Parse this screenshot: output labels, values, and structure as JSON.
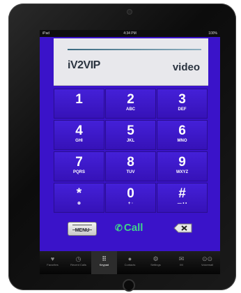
{
  "status_bar": {
    "carrier": "iPad",
    "time": "4:34 PM",
    "battery": "100%"
  },
  "display": {
    "logo_prefix": "iV",
    "logo_two": "2",
    "logo_suffix": "VIP",
    "mode_label": "video"
  },
  "keypad": {
    "keys": [
      {
        "digit": "1",
        "letters": ""
      },
      {
        "digit": "2",
        "letters": "ABC"
      },
      {
        "digit": "3",
        "letters": "DEF"
      },
      {
        "digit": "4",
        "letters": "GHI"
      },
      {
        "digit": "5",
        "letters": "JKL"
      },
      {
        "digit": "6",
        "letters": "MNO"
      },
      {
        "digit": "7",
        "letters": "PQRS"
      },
      {
        "digit": "8",
        "letters": "TUV"
      },
      {
        "digit": "9",
        "letters": "WXYZ"
      },
      {
        "digit": "*",
        "letters": "⊕"
      },
      {
        "digit": "0",
        "letters": "+ ·"
      },
      {
        "digit": "#",
        "letters": "— • •"
      }
    ]
  },
  "actions": {
    "menu_label": "MENU",
    "call_label": "Call",
    "call_icon": "phone-icon",
    "delete_icon": "backspace-icon"
  },
  "tabbar": {
    "items": [
      {
        "label": "Favorites",
        "icon": "heart-icon"
      },
      {
        "label": "Recent Calls",
        "icon": "clock-icon"
      },
      {
        "label": "Keypad",
        "icon": "keypad-icon"
      },
      {
        "label": "Contacts",
        "icon": "person-icon"
      },
      {
        "label": "Settings",
        "icon": "gear-icon"
      },
      {
        "label": "IM",
        "icon": "chat-icon"
      },
      {
        "label": "Voicemail",
        "icon": "voicemail-icon"
      }
    ],
    "active_index": 2
  }
}
